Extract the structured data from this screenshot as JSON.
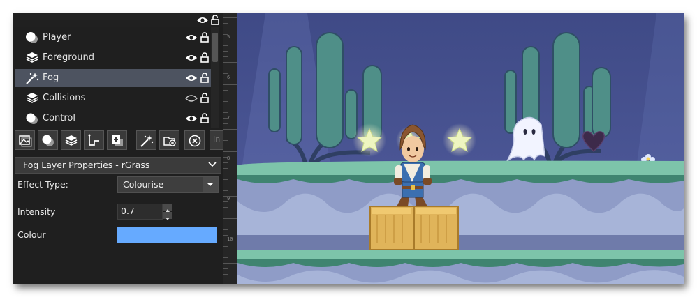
{
  "layers": [
    {
      "name": "Player",
      "icon": "instance-layer-icon",
      "visible": true,
      "selected": false
    },
    {
      "name": "Foreground",
      "icon": "tile-layer-icon",
      "visible": true,
      "selected": false
    },
    {
      "name": "Fog",
      "icon": "effect-layer-icon",
      "visible": true,
      "selected": true
    },
    {
      "name": "Collisions",
      "icon": "tile-layer-icon",
      "visible": false,
      "selected": false
    },
    {
      "name": "Control",
      "icon": "instance-layer-icon",
      "visible": true,
      "selected": false
    }
  ],
  "toolbar": {
    "buttons": [
      "background-layer-icon",
      "instance-layer-icon",
      "tile-layer-icon",
      "path-layer-icon",
      "asset-layer-icon",
      "effect-layer-icon",
      "add-folder-icon",
      "delete-layer-icon"
    ],
    "overflow_label": "In"
  },
  "properties": {
    "title": "Fog Layer Properties - rGrass",
    "effect_type_label": "Effect Type:",
    "effect_type_value": "Colourise",
    "intensity_label": "Intensity",
    "intensity_value": "0.7",
    "colour_label": "Colour",
    "colour_value": "#66aaff"
  },
  "ruler": {
    "labels": [
      "5",
      "6",
      "7",
      "8",
      "9",
      "10"
    ]
  },
  "colors": {
    "sky": "#4a5592",
    "grass": "#79c2a8",
    "ground": "#8f9cc7",
    "crate": "#e0b45a",
    "star": "#eef5c0",
    "heart": "#3d2a4a"
  }
}
